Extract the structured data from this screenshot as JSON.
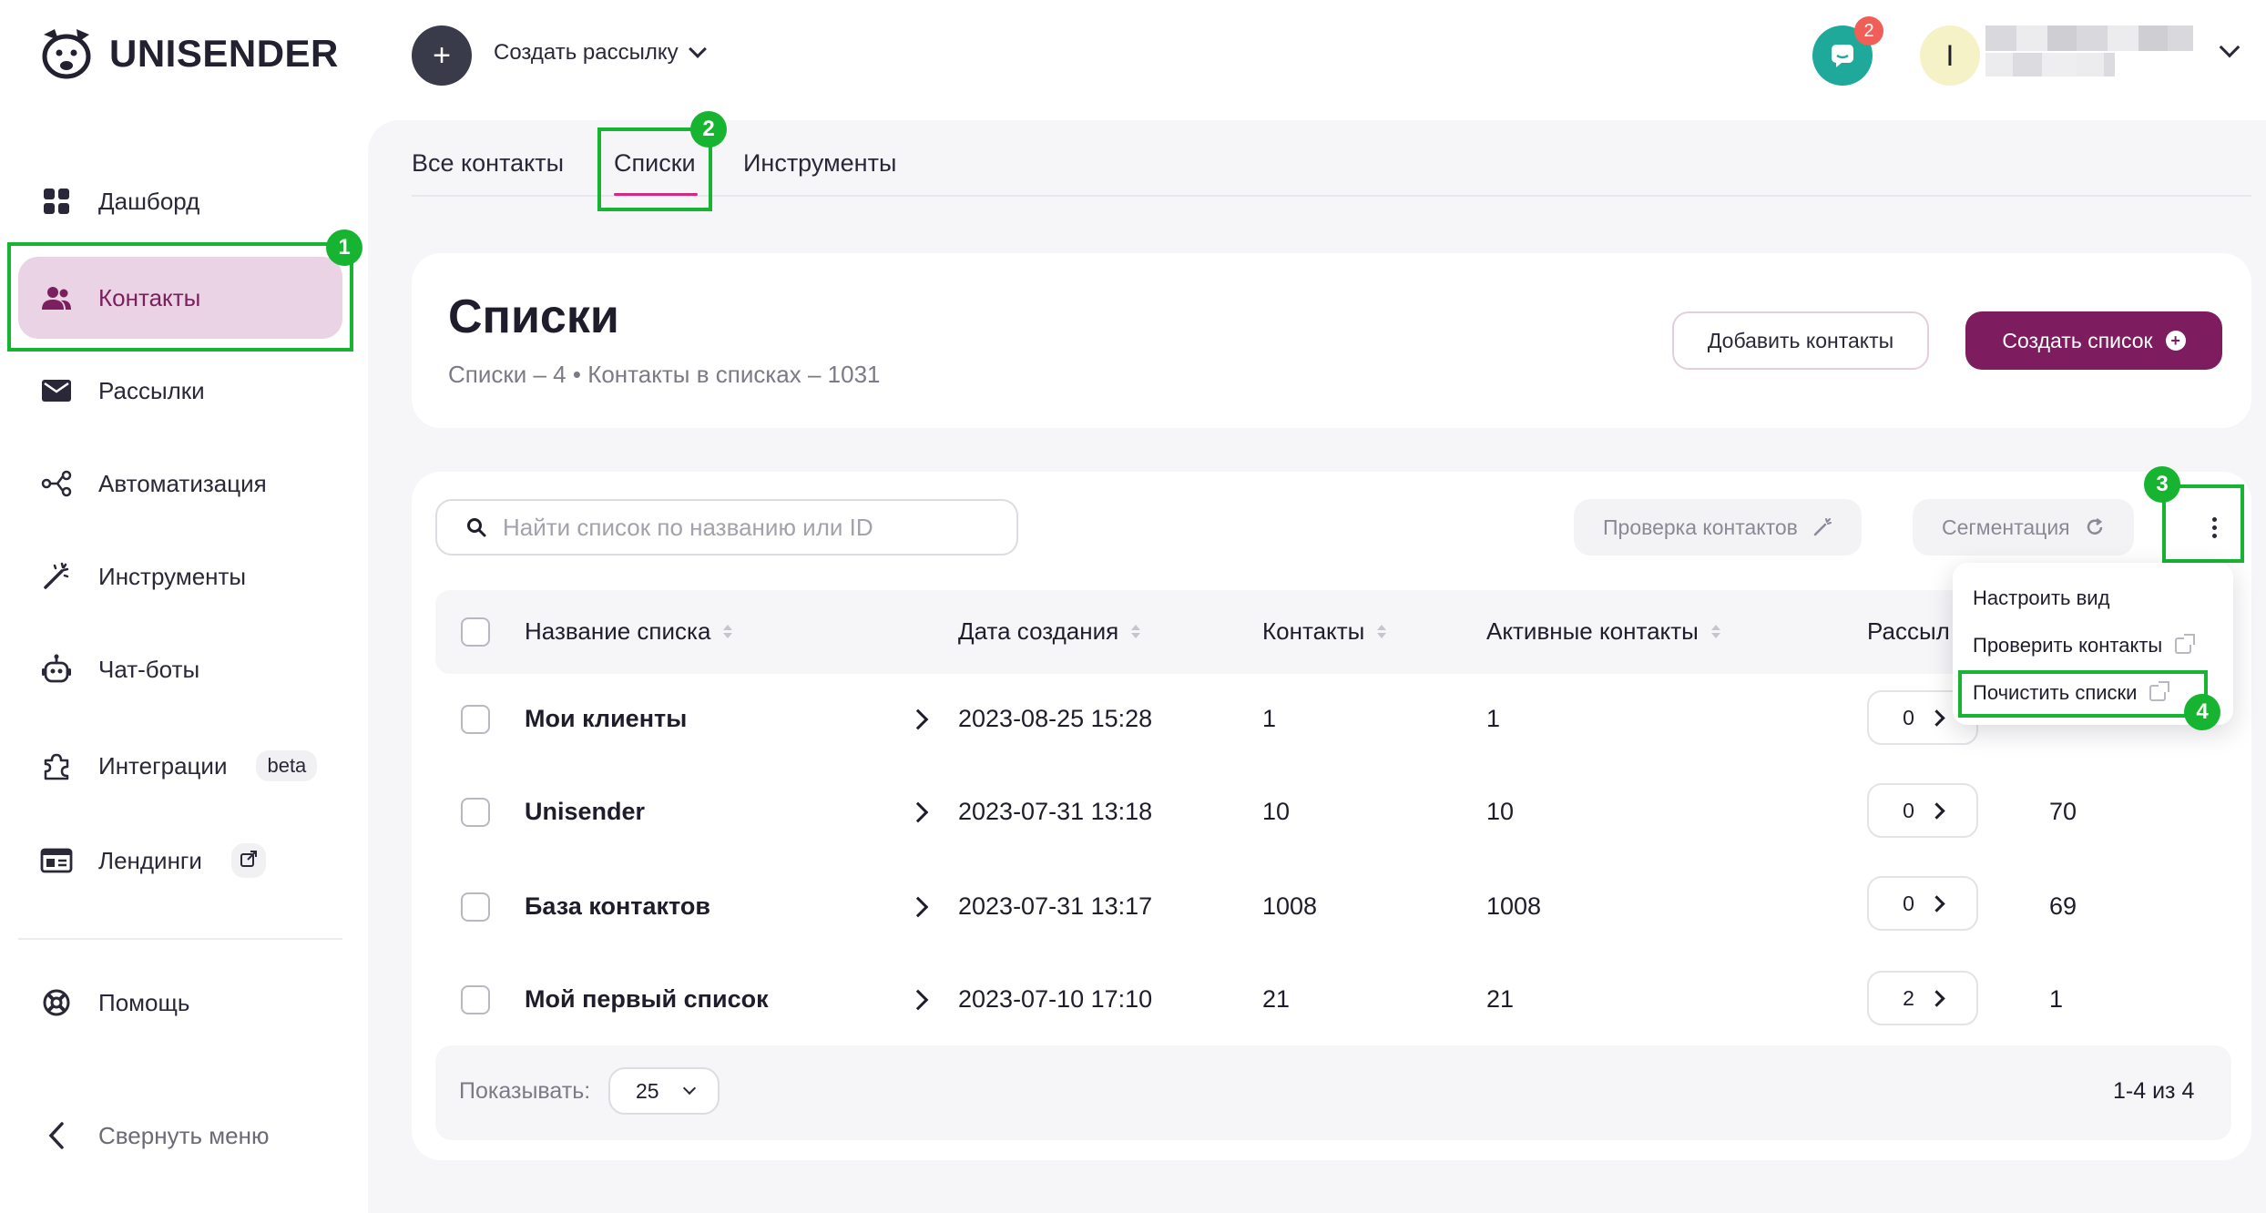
{
  "brand": {
    "name": "UNISENDER"
  },
  "topbar": {
    "create_label": "Создать рассылку",
    "chat_badge": "2",
    "avatar_initial": "I"
  },
  "sidebar": {
    "items": [
      {
        "label": "Дашборд",
        "icon": "dashboard-icon"
      },
      {
        "label": "Контакты",
        "icon": "contacts-icon",
        "active": true
      },
      {
        "label": "Рассылки",
        "icon": "mail-icon"
      },
      {
        "label": "Автоматизация",
        "icon": "automation-icon"
      },
      {
        "label": "Инструменты",
        "icon": "magic-wand-icon"
      },
      {
        "label": "Чат-боты",
        "icon": "bot-icon"
      },
      {
        "label": "Интеграции",
        "icon": "puzzle-icon",
        "tag": "beta"
      },
      {
        "label": "Лендинги",
        "icon": "landing-icon"
      }
    ],
    "help": "Помощь",
    "collapse": "Свернуть меню"
  },
  "tabs": [
    "Все контакты",
    "Списки",
    "Инструменты"
  ],
  "page": {
    "title": "Списки",
    "subtitle": "Списки – 4 • Контакты в списках – 1031",
    "add_contacts": "Добавить контакты",
    "create_list": "Создать список"
  },
  "toolbar": {
    "search_placeholder": "Найти список по названию или ID",
    "check_contacts": "Проверка контактов",
    "segmentation": "Сегментация"
  },
  "table": {
    "headers": [
      "Название списка",
      "Дата создания",
      "Контакты",
      "Активные контакты",
      "Рассыл"
    ],
    "rows": [
      {
        "name": "Мои клиенты",
        "date": "2023-08-25 15:28",
        "contacts": "1",
        "active": "1",
        "mailings": "0",
        "extra": ""
      },
      {
        "name": "Unisender",
        "date": "2023-07-31 13:18",
        "contacts": "10",
        "active": "10",
        "mailings": "0",
        "extra": "70"
      },
      {
        "name": "База контактов",
        "date": "2023-07-31 13:17",
        "contacts": "1008",
        "active": "1008",
        "mailings": "0",
        "extra": "69"
      },
      {
        "name": "Мой первый список",
        "date": "2023-07-10 17:10",
        "contacts": "21",
        "active": "21",
        "mailings": "2",
        "extra": "1"
      }
    ]
  },
  "footer": {
    "show_label": "Показывать:",
    "per_page": "25",
    "pager": "1-4 из 4"
  },
  "menu": {
    "items": [
      "Настроить вид",
      "Проверить контакты",
      "Почистить списки"
    ]
  },
  "annotations": [
    "1",
    "2",
    "3",
    "4"
  ],
  "colors": {
    "accent": "#7d1d60",
    "active_nav_bg": "#ead3e4",
    "highlight": "#17b431",
    "chat": "#1fa99a",
    "badge": "#ef5f57"
  }
}
